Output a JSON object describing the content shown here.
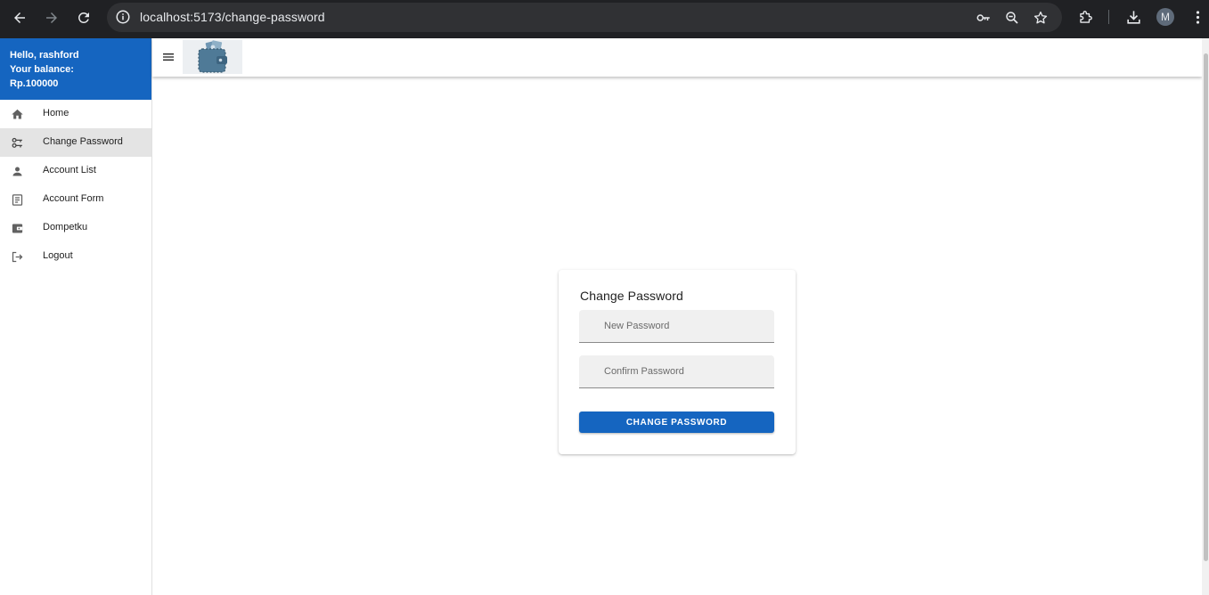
{
  "browser": {
    "url": "localhost:5173/change-password",
    "profile_initial": "M"
  },
  "sidebar": {
    "greeting": "Hello, rashford",
    "balance_label": "Your balance:",
    "balance_value": "Rp.100000",
    "items": [
      {
        "label": "Home",
        "icon": "home-icon"
      },
      {
        "label": "Change Password",
        "icon": "key-icon",
        "active": true
      },
      {
        "label": "Account List",
        "icon": "person-icon"
      },
      {
        "label": "Account Form",
        "icon": "form-icon"
      },
      {
        "label": "Dompetku",
        "icon": "wallet-icon"
      },
      {
        "label": "Logout",
        "icon": "logout-icon"
      }
    ]
  },
  "form": {
    "title": "Change Password",
    "new_password_placeholder": "New Password",
    "confirm_password_placeholder": "Confirm Password",
    "submit_label": "CHANGE PASSWORD"
  },
  "colors": {
    "primary": "#1565c0",
    "chrome_bg": "#202124",
    "active_nav_bg": "#e4e4e4",
    "logo_wallet": "#4f7a97"
  }
}
